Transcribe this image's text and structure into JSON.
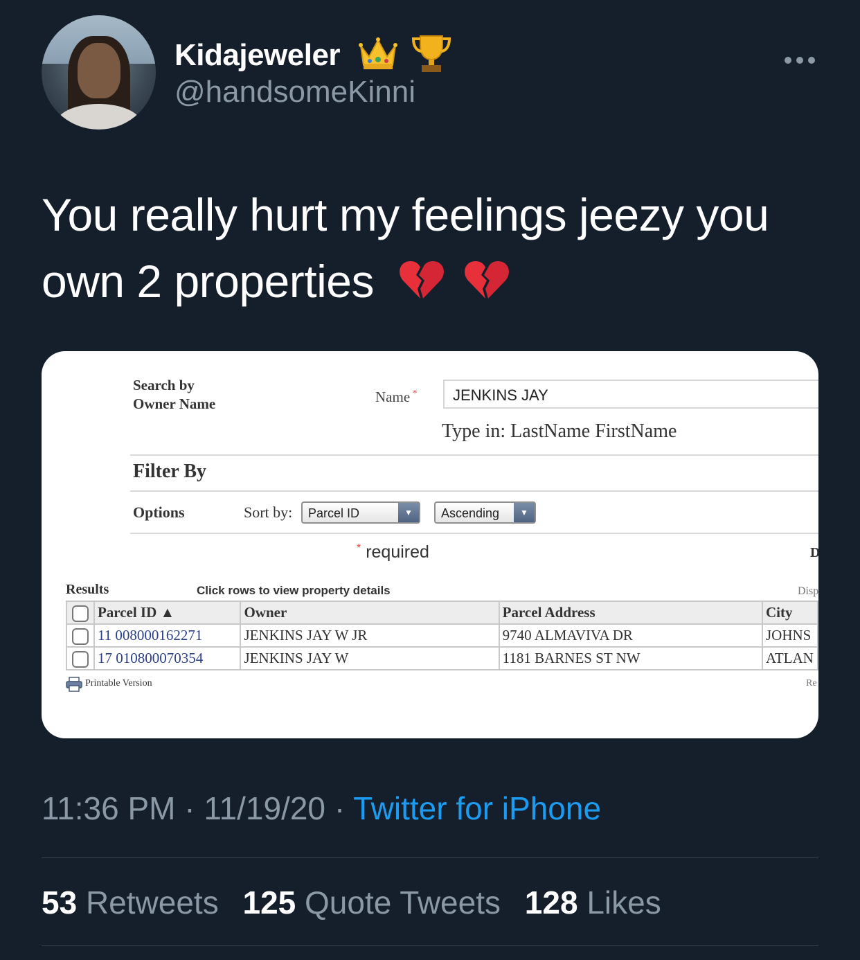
{
  "author": {
    "display_name": "Kidajeweler",
    "handle": "@handsomeKinni",
    "badges": [
      "crown-emoji",
      "trophy-emoji"
    ]
  },
  "more_icon": "more-dots-icon",
  "tweet": {
    "text": "You really hurt my feelings jeezy you own 2 properties",
    "emojis": [
      "broken-heart-emoji",
      "broken-heart-emoji"
    ]
  },
  "screenshot": {
    "search_by_line1": "Search by",
    "search_by_line2": "Owner Name",
    "name_label": "Name",
    "name_value": "JENKINS JAY",
    "type_in_hint": "Type in: LastName FirstName",
    "filter_by": "Filter By",
    "options": "Options",
    "sort_by": "Sort by:",
    "sort_field": "Parcel ID",
    "sort_order": "Ascending",
    "required": "required",
    "cut_letter": "D",
    "results": "Results",
    "click_rows": "Click rows to view property details",
    "disp": "Disp",
    "columns": [
      "Parcel ID ▲",
      "Owner",
      "Parcel Address",
      "City"
    ],
    "rows": [
      {
        "parcel_id": "11 008000162271",
        "owner": "JENKINS JAY W JR",
        "address": "9740 ALMAVIVA DR",
        "city": "JOHNS"
      },
      {
        "parcel_id": "17 010800070354",
        "owner": "JENKINS JAY W",
        "address": "1181 BARNES ST NW",
        "city": "ATLAN"
      }
    ],
    "printable": "Printable Version",
    "re": "Re"
  },
  "meta": {
    "time": "11:36 PM",
    "date": "11/19/20",
    "source": "Twitter for iPhone"
  },
  "stats": {
    "retweets_count": "53",
    "retweets_label": "Retweets",
    "quotes_count": "125",
    "quotes_label": "Quote Tweets",
    "likes_count": "128",
    "likes_label": "Likes"
  },
  "colors": {
    "background": "#151f2b",
    "secondary_text": "#8b98a5",
    "link": "#1d9bf0",
    "broken_heart": "#e8303a"
  }
}
